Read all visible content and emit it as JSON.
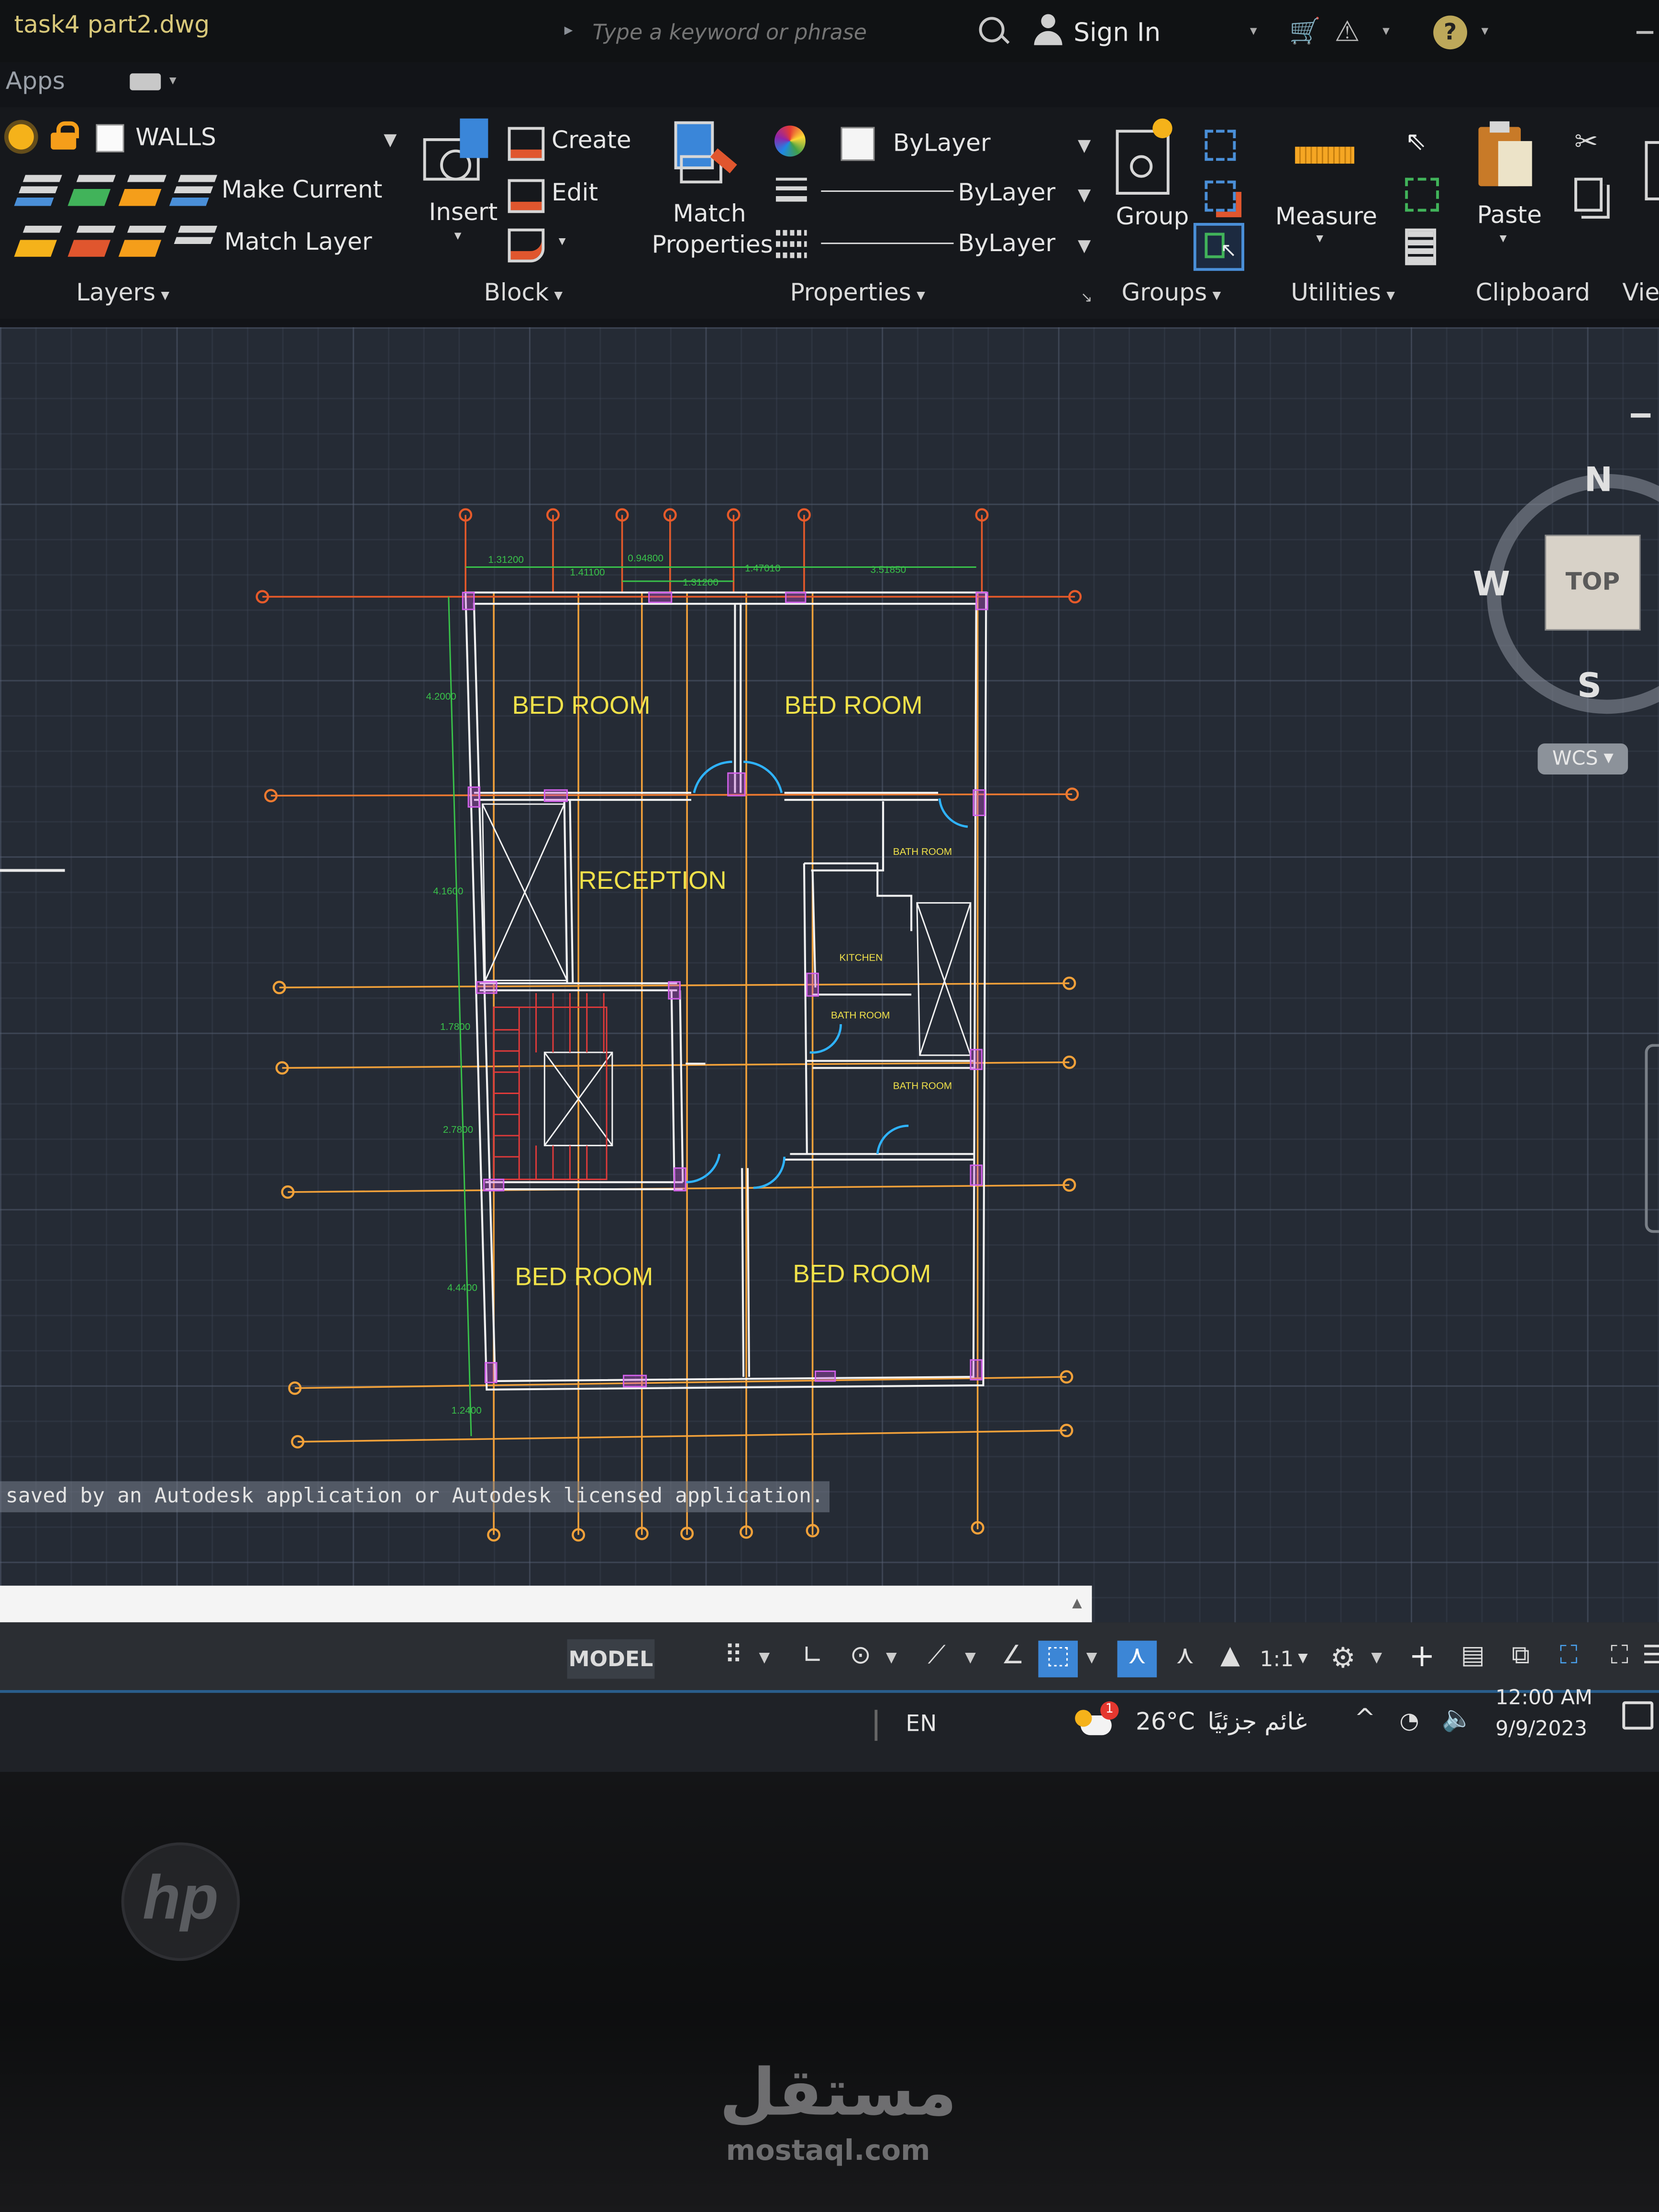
{
  "window": {
    "title": "task4 part2.dwg"
  },
  "search": {
    "placeholder": "Type a keyword or phrase"
  },
  "header": {
    "sign_in": "Sign In"
  },
  "ribbon": {
    "tab_apps": "Apps",
    "layers": {
      "current_layer": "WALLS",
      "make_current": "Make Current",
      "match_layer": "Match Layer",
      "panel": "Layers"
    },
    "block": {
      "insert": "Insert",
      "create": "Create",
      "edit": "Edit",
      "panel": "Block"
    },
    "properties": {
      "match_properties_1": "Match",
      "match_properties_2": "Properties",
      "color": "ByLayer",
      "linetype": "ByLayer",
      "lineweight": "ByLayer",
      "panel": "Properties"
    },
    "groups": {
      "group": "Group",
      "panel": "Groups"
    },
    "utilities": {
      "measure": "Measure",
      "panel": "Utilities"
    },
    "clipboard": {
      "paste": "Paste",
      "panel": "Clipboard"
    },
    "view": {
      "panel": "Vie"
    }
  },
  "viewcube": {
    "north": "N",
    "south": "S",
    "west": "W",
    "face": "TOP",
    "wcs": "WCS"
  },
  "plan": {
    "rooms": {
      "bed_tl": "BED ROOM",
      "bed_tr": "BED ROOM",
      "reception": "RECEPTION",
      "bath_1": "BATH ROOM",
      "kitchen": "KITCHEN",
      "bath_2": "BATH ROOM",
      "bath_3": "BATH ROOM",
      "bed_bl": "BED ROOM",
      "bed_br": "BED ROOM"
    },
    "dims_top": [
      "1.31200",
      "1.41100",
      "0.94800",
      "1.31200",
      "1.47010",
      "3.51850"
    ],
    "dims_left": [
      "4.2000",
      "4.1600",
      "1.7800",
      "2.7800",
      "4.4400",
      "1.2400"
    ]
  },
  "command_line": {
    "message": "saved by an Autodesk application or Autodesk licensed application."
  },
  "status_bar": {
    "model": "MODEL",
    "scale": "1:1"
  },
  "taskbar": {
    "lang": "EN",
    "weather_badge": "1",
    "temperature": "26°C",
    "weather_text": "غائم جزئيًا",
    "time": "12:00 AM",
    "date": "9/9/2023"
  },
  "monitor": {
    "brand": "hp"
  },
  "watermark": {
    "arabic": "مستقل",
    "latin": "mostaql.com"
  }
}
